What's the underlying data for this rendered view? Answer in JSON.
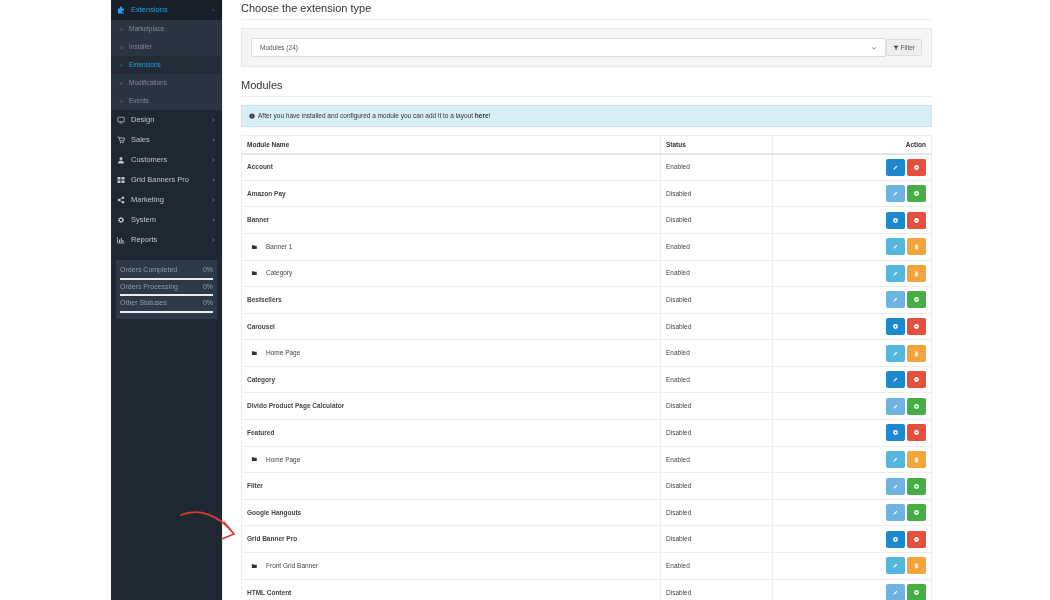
{
  "sidebar": {
    "items": [
      {
        "label": "Extensions",
        "selected": true,
        "children": [
          {
            "label": "Marketplace",
            "selected": false
          },
          {
            "label": "Installer",
            "selected": false
          },
          {
            "label": "Extensions",
            "selected": true
          },
          {
            "label": "Modifications",
            "selected": false
          },
          {
            "label": "Events",
            "selected": false
          }
        ]
      },
      {
        "label": "Design",
        "selected": false
      },
      {
        "label": "Sales",
        "selected": false
      },
      {
        "label": "Customers",
        "selected": false
      },
      {
        "label": "Grid Banners Pro",
        "selected": false
      },
      {
        "label": "Marketing",
        "selected": false
      },
      {
        "label": "System",
        "selected": false
      },
      {
        "label": "Reports",
        "selected": false
      }
    ],
    "stats": [
      {
        "label": "Orders Completed",
        "reading": "0%",
        "level": 0
      },
      {
        "label": "Orders Processing",
        "reading": "0%",
        "level": 0
      },
      {
        "label": "Other Statuses",
        "reading": "0%",
        "level": 0
      }
    ]
  },
  "heading": "Choose the extension type",
  "filter": {
    "value": "Modules (24)",
    "button": "Filter"
  },
  "section_title": "Modules",
  "alert": "After you have installed and configured a module you can add it to a layout **here**!",
  "table": {
    "columns": [
      "Module Name",
      "Status",
      "Action"
    ],
    "rows": [
      {
        "name": "Account",
        "status": "Enabled",
        "kind": "edit"
      },
      {
        "name": "Amazon Pay",
        "status": "Disabled",
        "kind": "available"
      },
      {
        "name": "Banner",
        "status": "Disabled",
        "kind": "add",
        "children": [
          {
            "name": "Banner 1",
            "status": "Enabled"
          },
          {
            "name": "Category",
            "status": "Enabled"
          }
        ]
      },
      {
        "name": "Bestsellers",
        "status": "Disabled",
        "kind": "available"
      },
      {
        "name": "Carousel",
        "status": "Disabled",
        "kind": "add",
        "children": [
          {
            "name": "Home Page",
            "status": "Enabled"
          }
        ]
      },
      {
        "name": "Category",
        "status": "Enabled",
        "kind": "edit"
      },
      {
        "name": "Divido Product Page Calculator",
        "status": "Disabled",
        "kind": "available"
      },
      {
        "name": "Featured",
        "status": "Disabled",
        "kind": "add",
        "children": [
          {
            "name": "Home Page",
            "status": "Enabled"
          }
        ]
      },
      {
        "name": "Filter",
        "status": "Disabled",
        "kind": "available"
      },
      {
        "name": "Google Hangouts",
        "status": "Disabled",
        "kind": "available"
      },
      {
        "name": "Grid Banner Pro",
        "status": "Disabled",
        "kind": "add",
        "children": [
          {
            "name": "Front Grid Banner",
            "status": "Enabled"
          }
        ]
      },
      {
        "name": "HTML Content",
        "status": "Disabled",
        "kind": "available"
      }
    ]
  }
}
